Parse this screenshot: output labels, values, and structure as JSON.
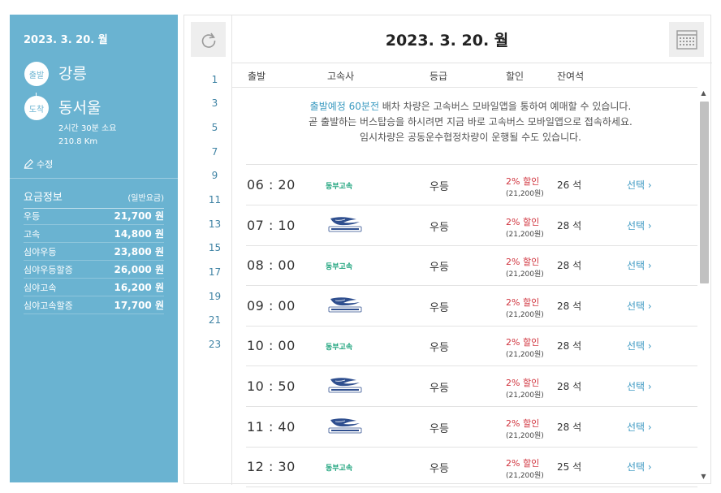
{
  "left": {
    "date": "2023. 3. 20. 월",
    "departure_badge": "출발",
    "departure": "강릉",
    "arrival_badge": "도착",
    "arrival": "동서울",
    "duration": "2시간 30분 소요",
    "distance": "210.8 Km",
    "edit_label": "수정",
    "fare_title": "요금정보",
    "fare_subtitle": "(일반요금)",
    "fares": [
      {
        "name": "우등",
        "price": "21,700 원"
      },
      {
        "name": "고속",
        "price": "14,800 원"
      },
      {
        "name": "심야우등",
        "price": "23,800 원"
      },
      {
        "name": "심야우등할증",
        "price": "26,000 원"
      },
      {
        "name": "심야고속",
        "price": "16,200 원"
      },
      {
        "name": "심야고속할증",
        "price": "17,700 원"
      }
    ]
  },
  "main": {
    "date": "2023. 3. 20. 월",
    "hours": [
      "1",
      "3",
      "5",
      "7",
      "9",
      "11",
      "13",
      "15",
      "17",
      "19",
      "21",
      "23"
    ],
    "columns": {
      "depart": "출발",
      "company": "고속사",
      "grade": "등급",
      "discount": "할인",
      "seats": "잔여석"
    },
    "notice": {
      "highlight": "출발예정 60분전",
      "line1_rest": " 배차 차량은 고속버스 모바일앱을 통하여 예매할 수 있습니다.",
      "line2": "곧 출발하는 버스탑승을 하시려면 지금 바로 고속버스 모바일앱으로 접속하세요.",
      "line3": "임시차량은 공동운수협정차량이 운행될 수도 있습니다."
    },
    "rows": [
      {
        "time": "06 : 20",
        "company": "동부고속",
        "logo": false,
        "grade": "우등",
        "discount": "2% 할인",
        "price": "(21,200원)",
        "seats": "26 석",
        "select": "선택 ›"
      },
      {
        "time": "07 : 10",
        "company": "중앙고속",
        "logo": true,
        "grade": "우등",
        "discount": "2% 할인",
        "price": "(21,200원)",
        "seats": "28 석",
        "select": "선택 ›"
      },
      {
        "time": "08 : 00",
        "company": "동부고속",
        "logo": false,
        "grade": "우등",
        "discount": "2% 할인",
        "price": "(21,200원)",
        "seats": "28 석",
        "select": "선택 ›"
      },
      {
        "time": "09 : 00",
        "company": "중앙고속",
        "logo": true,
        "grade": "우등",
        "discount": "2% 할인",
        "price": "(21,200원)",
        "seats": "28 석",
        "select": "선택 ›"
      },
      {
        "time": "10 : 00",
        "company": "동부고속",
        "logo": false,
        "grade": "우등",
        "discount": "2% 할인",
        "price": "(21,200원)",
        "seats": "28 석",
        "select": "선택 ›"
      },
      {
        "time": "10 : 50",
        "company": "중앙고속",
        "logo": true,
        "grade": "우등",
        "discount": "2% 할인",
        "price": "(21,200원)",
        "seats": "28 석",
        "select": "선택 ›"
      },
      {
        "time": "11 : 40",
        "company": "중앙고속",
        "logo": true,
        "grade": "우등",
        "discount": "2% 할인",
        "price": "(21,200원)",
        "seats": "28 석",
        "select": "선택 ›"
      },
      {
        "time": "12 : 30",
        "company": "동부고속",
        "logo": false,
        "grade": "우등",
        "discount": "2% 할인",
        "price": "(21,200원)",
        "seats": "25 석",
        "select": "선택 ›"
      }
    ],
    "colors": {
      "accent": "#6ab3d1",
      "discount": "#d0333d",
      "company_green": "#19a27a",
      "link": "#3f9ac3"
    }
  }
}
